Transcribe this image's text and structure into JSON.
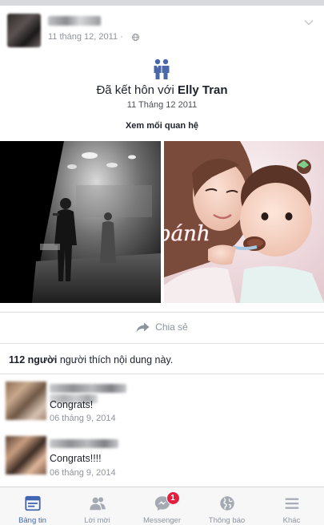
{
  "post": {
    "date": "11 tháng 12, 2011",
    "date_separator": "·"
  },
  "life_event": {
    "prefix": "Đã kết hôn với",
    "partner": "Elly Tran",
    "date": "11 Tháng 12 2011",
    "link": "Xem mối quan hệ"
  },
  "photos": {
    "overlay_text": "bánh"
  },
  "actions": {
    "share_label": "Chia sẻ"
  },
  "likes": {
    "count": "112 người",
    "rest": "người thích nội dung này."
  },
  "comments": [
    {
      "text": "Congrats!",
      "date": "06 tháng 9, 2014"
    },
    {
      "text": "Congrats!!!!",
      "date": "06 tháng 9, 2014"
    }
  ],
  "tabbar": {
    "tabs": [
      {
        "label": "Bảng tin",
        "icon": "news-feed-icon",
        "active": true
      },
      {
        "label": "Lời mời",
        "icon": "friend-requests-icon",
        "active": false
      },
      {
        "label": "Messenger",
        "icon": "messenger-icon",
        "active": false,
        "badge": "1"
      },
      {
        "label": "Thông báo",
        "icon": "globe-icon",
        "active": false
      },
      {
        "label": "Khác",
        "icon": "menu-icon",
        "active": false
      }
    ]
  },
  "colors": {
    "accent": "#4267b2",
    "badge": "#e41e3f",
    "muted": "#90949c"
  }
}
